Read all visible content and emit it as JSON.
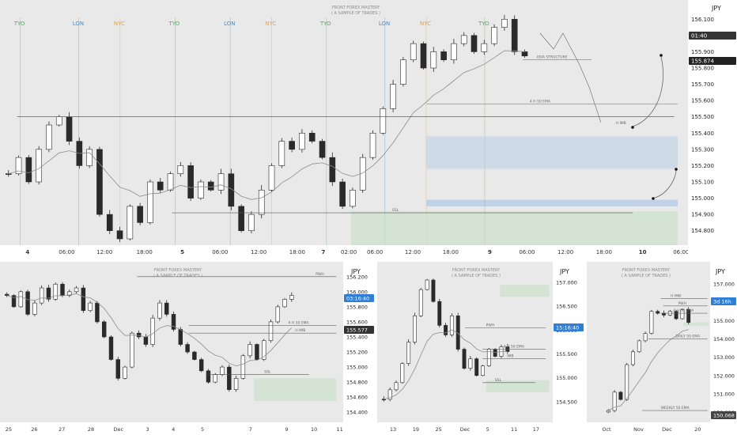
{
  "watermark": {
    "line1": "FRONT FOREX MASTERY",
    "line2": "( A SAMPLE OF TRADES )"
  },
  "currency": "JPY",
  "main": {
    "y_ticks": [
      "156.100",
      "156.000",
      "155.900",
      "155.800",
      "155.700",
      "155.600",
      "155.500",
      "155.400",
      "155.300",
      "155.200",
      "155.100",
      "155.000",
      "154.900",
      "154.800"
    ],
    "x_ticks": [
      "4",
      "06:00",
      "12:00",
      "18:00",
      "5",
      "06:00",
      "12:00",
      "18:00",
      "7",
      "02:00",
      "06:00",
      "12:00",
      "18:00",
      "9",
      "06:00",
      "12:00",
      "18:00",
      "10",
      "06:00"
    ],
    "sessions": [
      "TYO",
      "LON",
      "NYC",
      "TYO",
      "LON",
      "NYC",
      "TYO",
      "LON",
      "NYC",
      "TYO"
    ],
    "badges": [
      "01:40",
      "155.874"
    ],
    "annotations": [
      "ASIA STRUCTURE",
      "4 H 50 EMA",
      "H IMB",
      "SSL"
    ],
    "colors": {
      "tyo": "#5aa96a",
      "lon": "#3f8fd0",
      "nyc": "#e8a33d"
    }
  },
  "p1": {
    "y_ticks": [
      "156.200",
      "156.000",
      "155.800",
      "155.600",
      "155.400",
      "155.200",
      "155.000",
      "154.800",
      "154.600",
      "154.400"
    ],
    "x_ticks": [
      "25",
      "26",
      "27",
      "28",
      "Dec",
      "3",
      "4",
      "5",
      "7",
      "9",
      "10",
      "11"
    ],
    "badges": [
      "03:16:40",
      "155.577"
    ],
    "annotations": [
      "PWH",
      "4 H 50 EMA",
      "H IMB",
      "SSL"
    ]
  },
  "p2": {
    "y_ticks": [
      "157.000",
      "156.500",
      "156.000",
      "155.500",
      "155.000",
      "154.500"
    ],
    "x_ticks": [
      "13",
      "19",
      "25",
      "Dec",
      "5",
      "11",
      "17"
    ],
    "badges": [
      "15:16:40"
    ],
    "annotations": [
      "PWH",
      "4 H 50 EMA",
      "IMB",
      "SSL"
    ]
  },
  "p3": {
    "y_ticks": [
      "157.000",
      "155.000",
      "154.000",
      "153.000",
      "152.000",
      "151.000",
      "150.000"
    ],
    "x_ticks": [
      "Oct",
      "Nov",
      "Dec",
      "20"
    ],
    "badges": [
      "3d 16h",
      "150.068"
    ],
    "annotations": [
      "H IMB",
      "PWH",
      "4 H 50 EMA",
      "DAILY 50 EMA",
      "WEEKLY 50 EMA"
    ]
  },
  "chart_data": [
    {
      "type": "candlestick",
      "title": "",
      "ylim": [
        154.75,
        156.15
      ],
      "series": [
        {
          "values": [
            155.15,
            155.25,
            155.1,
            155.3,
            155.45,
            155.5,
            155.35,
            155.2,
            155.3,
            154.9,
            154.8,
            154.75,
            154.95,
            154.85,
            155.1,
            155.05,
            155.15,
            155.2,
            155.0,
            155.1,
            155.05,
            155.15,
            154.95,
            154.8,
            154.9,
            155.05,
            155.2,
            155.35,
            155.3,
            155.4,
            155.35,
            155.25,
            155.1,
            154.95,
            155.05,
            155.25,
            155.4,
            155.55,
            155.7,
            155.85,
            155.95,
            155.8,
            155.9,
            155.85,
            155.95,
            156.0,
            155.9,
            155.95,
            156.05,
            156.1,
            155.9,
            155.874
          ]
        }
      ]
    },
    {
      "type": "candlestick",
      "title": "",
      "ylim": [
        154.35,
        156.25
      ],
      "series": [
        {
          "values": [
            155.95,
            155.8,
            156.0,
            155.7,
            155.85,
            156.05,
            155.9,
            156.1,
            155.95,
            156.0,
            156.05,
            155.75,
            155.85,
            155.6,
            155.4,
            155.1,
            154.85,
            155.0,
            155.45,
            155.4,
            155.3,
            155.65,
            155.85,
            155.7,
            155.5,
            155.3,
            155.2,
            155.1,
            154.95,
            154.8,
            154.9,
            155.0,
            154.7,
            154.85,
            155.15,
            155.3,
            155.1,
            155.35,
            155.6,
            155.8,
            155.9,
            155.95
          ]
        }
      ]
    },
    {
      "type": "candlestick",
      "title": "",
      "ylim": [
        154.2,
        157.2
      ],
      "series": [
        {
          "values": [
            154.55,
            154.75,
            154.9,
            155.3,
            155.75,
            156.3,
            156.85,
            157.05,
            156.6,
            156.1,
            155.9,
            156.3,
            155.6,
            155.2,
            155.4,
            155.05,
            155.25,
            155.6,
            155.45,
            155.65,
            155.55
          ]
        }
      ]
    },
    {
      "type": "candlestick",
      "title": "",
      "ylim": [
        149.8,
        157.6
      ],
      "series": [
        {
          "values": [
            150.1,
            151.1,
            150.7,
            152.6,
            153.3,
            153.9,
            154.3,
            155.5,
            155.4,
            155.3,
            155.5,
            155.1,
            155.6,
            154.9
          ]
        }
      ]
    }
  ]
}
